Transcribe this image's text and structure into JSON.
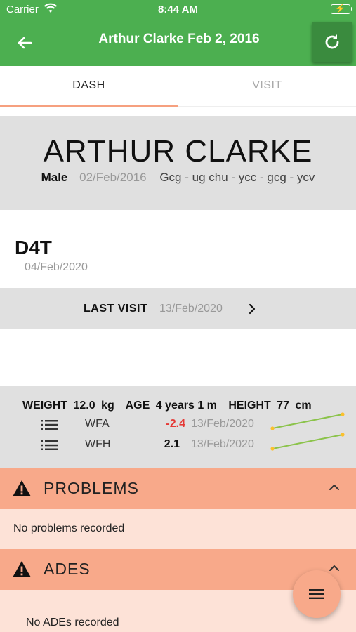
{
  "status_bar": {
    "carrier": "Carrier",
    "time": "8:44 AM",
    "battery_icon": "battery-charging-icon",
    "wifi_icon": "wifi-icon"
  },
  "app_bar": {
    "title": "Arthur Clarke Feb 2, 2016",
    "back_icon": "arrow-left-icon",
    "refresh_icon": "refresh-icon",
    "color": "#4caf50"
  },
  "tabs": [
    {
      "label": "DASH",
      "selected": true
    },
    {
      "label": "VISIT",
      "selected": false
    }
  ],
  "patient": {
    "name": "ARTHUR CLARKE",
    "sex": "Male",
    "dob": "02/Feb/2016",
    "code": "Gcg - ug chu - ycc - gcg - ycv"
  },
  "encounter": {
    "title": "D4T",
    "date": "04/Feb/2020"
  },
  "last_visit": {
    "label": "LAST VISIT",
    "date": "13/Feb/2020"
  },
  "growth": {
    "weight_label": "WEIGHT",
    "weight_value": "12.0",
    "weight_unit": "kg",
    "age_label": "AGE",
    "age_value": "4 years 1 m",
    "height_label": "HEIGHT",
    "height_value": "77",
    "height_unit": "cm",
    "rows": [
      {
        "metric": "WFA",
        "zscore": "-2.4",
        "date": "13/Feb/2020",
        "negative": true
      },
      {
        "metric": "WFH",
        "zscore": "2.1",
        "date": "13/Feb/2020",
        "negative": false
      }
    ]
  },
  "problems": {
    "title": "PROBLEMS",
    "empty_text": "No problems recorded"
  },
  "ades": {
    "title": "ADES",
    "empty_text": "No ADEs recorded"
  },
  "colors": {
    "accent": "#f8a98a",
    "section_body": "#fde2d7",
    "panel_gray": "#e0e0e0",
    "negative": "#e53935",
    "spark_line": "#8bc34a",
    "spark_point": "#fbc02d"
  }
}
